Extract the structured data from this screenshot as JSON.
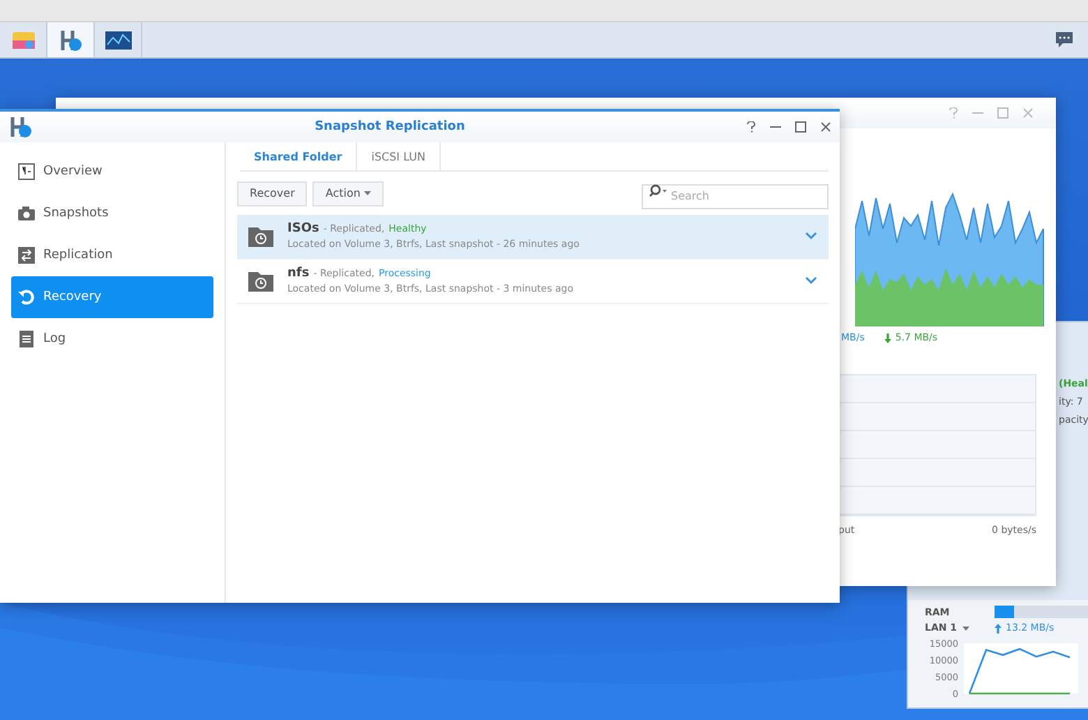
{
  "taskbar": {
    "apps": [
      {
        "kind": "photos",
        "selected": false
      },
      {
        "kind": "snapshot",
        "selected": true
      },
      {
        "kind": "monitor",
        "selected": false
      }
    ]
  },
  "resource_widget": {
    "status_lines": [
      {
        "text": "(Heal",
        "color": "#3aa53a"
      },
      {
        "text": "ity: 7",
        "color": "#555555"
      },
      {
        "text": "pacity",
        "color": "#555555"
      }
    ],
    "ram": {
      "label": "RAM",
      "level": 0.2
    },
    "lan": {
      "label": "LAN 1",
      "rate": "13.2 MB/s"
    },
    "chart_data": {
      "type": "line",
      "ylim": [
        0,
        15000
      ],
      "yticks": [
        0,
        5000,
        10000,
        15000
      ],
      "series": [
        {
          "color": "#2f8fe0",
          "values": [
            0,
            13000,
            11500,
            13300,
            11000,
            12500,
            10800
          ]
        },
        {
          "color": "#4caf50",
          "values": [
            0,
            0,
            0,
            0,
            0,
            0,
            0
          ]
        }
      ]
    }
  },
  "background_window": {
    "upload_rate": "MB/s",
    "download_rate": "5.7 MB/s",
    "io_label": "put",
    "io_value": "0 bytes/s"
  },
  "main_window": {
    "title": "Snapshot Replication",
    "sidebar": {
      "items": [
        {
          "label": "Overview",
          "kind": "overview",
          "selected": false
        },
        {
          "label": "Snapshots",
          "kind": "camera",
          "selected": false
        },
        {
          "label": "Replication",
          "kind": "replication",
          "selected": false
        },
        {
          "label": "Recovery",
          "kind": "recovery",
          "selected": true
        },
        {
          "label": "Log",
          "kind": "log",
          "selected": false
        }
      ]
    },
    "tabs": [
      {
        "label": "Shared Folder",
        "selected": true
      },
      {
        "label": "iSCSI LUN",
        "selected": false
      }
    ],
    "toolbar": {
      "buttons": [
        {
          "label": "Recover",
          "kind": "plain"
        },
        {
          "label": "Action",
          "kind": "dropdown"
        }
      ],
      "search": {
        "placeholder": "Search"
      }
    },
    "folders": [
      {
        "name": "ISOs",
        "summary": "- Replicated,",
        "status": "Healthy",
        "color": "#3aa53a",
        "detail": "Located on Volume 3, Btrfs, Last snapshot - 26 minutes ago",
        "selected": true
      },
      {
        "name": "nfs",
        "summary": "- Replicated,",
        "status": "Processing",
        "color": "#2f9be0",
        "detail": "Located on Volume 3, Btrfs, Last snapshot - 3 minutes ago",
        "selected": false
      }
    ]
  }
}
